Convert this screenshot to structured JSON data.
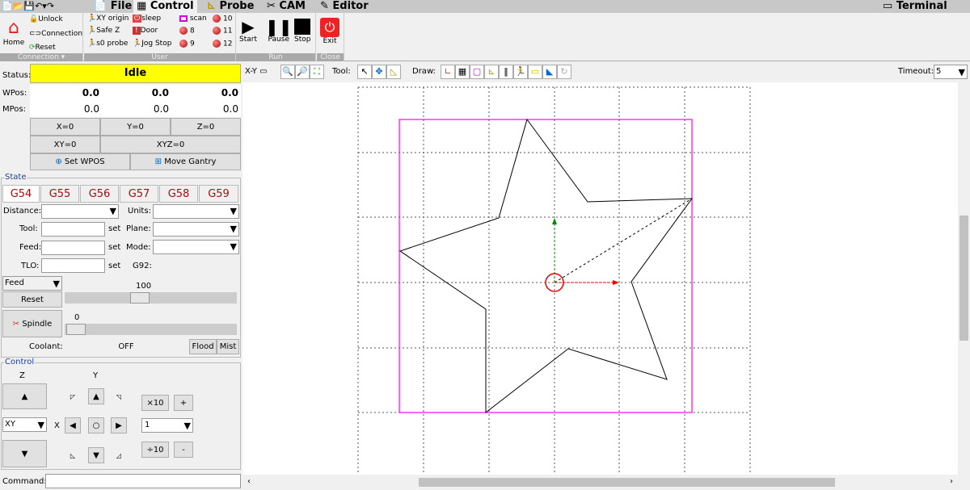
{
  "menu": {
    "tabs": [
      {
        "label": "File"
      },
      {
        "label": "Control"
      },
      {
        "label": "Probe"
      },
      {
        "label": "CAM"
      },
      {
        "label": "Editor"
      }
    ],
    "terminal": "Terminal"
  },
  "ribbon": {
    "connection": {
      "home": "Home",
      "unlock": "Unlock",
      "connection": "Connection",
      "reset": "Reset",
      "group": "Connection ▾"
    },
    "user": {
      "items": [
        "XY origin",
        "Safe Z",
        "s0 probe",
        "sleep",
        "Door",
        "Jog Stop",
        "scan",
        "8",
        "9",
        "10",
        "11",
        "12"
      ],
      "group": "User"
    },
    "run": {
      "start": "Start",
      "pause": "Pause",
      "stop": "Stop",
      "group": "Run"
    },
    "close": {
      "exit": "Exit",
      "group": "Close"
    }
  },
  "status": {
    "label": "Status:",
    "value": "Idle",
    "color": "#ffff00"
  },
  "wpos": {
    "label": "WPos:",
    "x": "0.0",
    "y": "0.0",
    "z": "0.0"
  },
  "mpos": {
    "label": "MPos:",
    "x": "0.0",
    "y": "0.0",
    "z": "0.0"
  },
  "zero": {
    "x": "X=0",
    "y": "Y=0",
    "z": "Z=0",
    "xy": "XY=0",
    "xyz": "XYZ=0",
    "set_wpos": "Set WPOS",
    "move_gantry": "Move Gantry"
  },
  "state": {
    "title": "State",
    "wcs": [
      "G54",
      "G55",
      "G56",
      "G57",
      "G58",
      "G59"
    ],
    "distance": "Distance:",
    "units": "Units:",
    "tool": "Tool:",
    "plane": "Plane:",
    "feed": "Feed:",
    "mode": "Mode:",
    "tlo": "TLO:",
    "g92": "G92:",
    "set": "set"
  },
  "overrides": {
    "feed_select": "Feed",
    "feed_value": "100",
    "reset": "Reset",
    "spindle": "Spindle",
    "spindle_value": "0",
    "coolant": "Coolant:",
    "off": "OFF",
    "flood": "Flood",
    "mist": "Mist"
  },
  "control": {
    "title": "Control",
    "z": "Z",
    "y": "Y",
    "x": "X",
    "plane": "XY",
    "x10": "×10",
    "plus": "+",
    "div10": "÷10",
    "minus": "-",
    "step": "1"
  },
  "command": {
    "label": "Command:",
    "value": ""
  },
  "canvas_toolbar": {
    "view": "X-Y",
    "tool": "Tool:",
    "draw": "Draw:",
    "timeout_label": "Timeout:",
    "timeout": "5"
  }
}
